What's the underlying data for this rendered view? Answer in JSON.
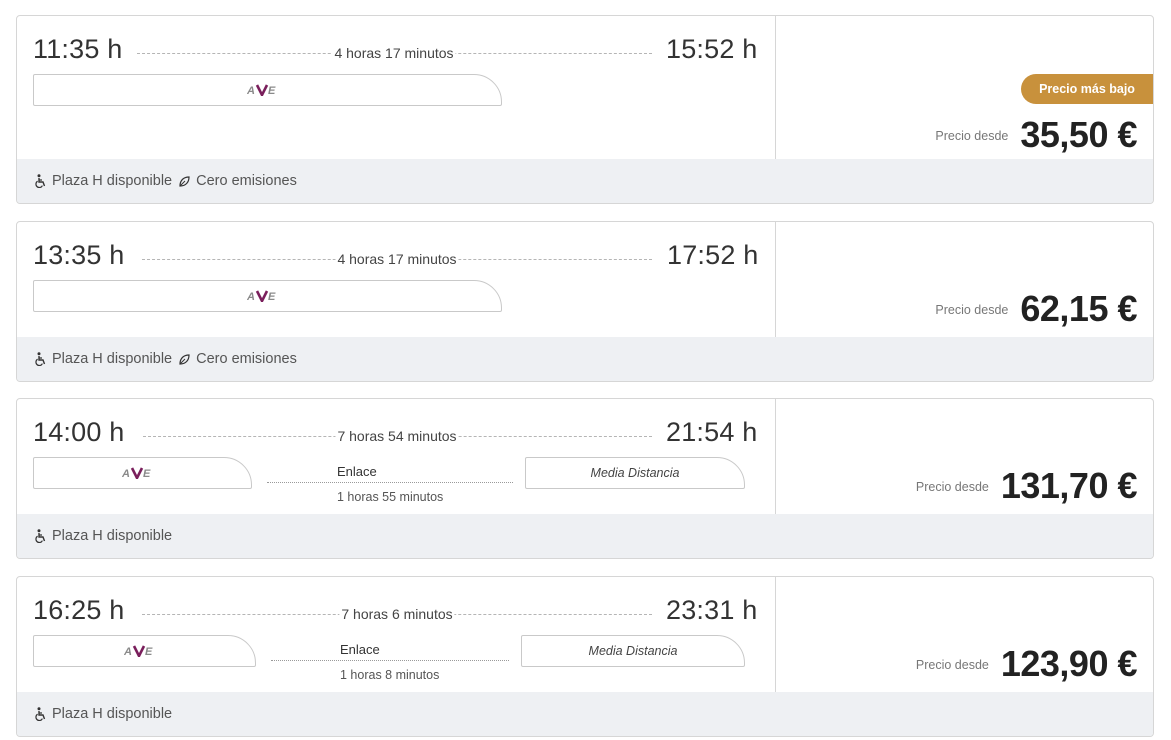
{
  "results": [
    {
      "departure": "11:35 h",
      "arrival": "15:52 h",
      "duration": "4 horas 17 minutos",
      "segments": [
        {
          "brand": "AVE"
        }
      ],
      "badge": "Precio más bajo",
      "price_label": "Precio desde",
      "price": "35,50 €",
      "features": [
        "Plaza H disponible",
        "Cero emisiones"
      ]
    },
    {
      "departure": "13:35 h",
      "arrival": "17:52 h",
      "duration": "4 horas 17 minutos",
      "segments": [
        {
          "brand": "AVE"
        }
      ],
      "price_label": "Precio desde",
      "price": "62,15 €",
      "features": [
        "Plaza H disponible",
        "Cero emisiones"
      ]
    },
    {
      "departure": "14:00 h",
      "arrival": "21:54 h",
      "duration": "7 horas 54 minutos",
      "segments": [
        {
          "brand": "AVE"
        },
        {
          "brand": "Media Distancia"
        }
      ],
      "connection_label": "Enlace",
      "connection_duration": "1 horas 55 minutos",
      "price_label": "Precio desde",
      "price": "131,70 €",
      "features": [
        "Plaza H disponible"
      ]
    },
    {
      "departure": "16:25 h",
      "arrival": "23:31 h",
      "duration": "7 horas 6 minutos",
      "segments": [
        {
          "brand": "AVE"
        },
        {
          "brand": "Media Distancia"
        }
      ],
      "connection_label": "Enlace",
      "connection_duration": "1 horas 8 minutos",
      "price_label": "Precio desde",
      "price": "123,90 €",
      "features": [
        "Plaza H disponible"
      ]
    }
  ],
  "colors": {
    "badge": "#c8913c",
    "ave_purple": "#7a1f5c",
    "footer_bg": "#eef0f3"
  },
  "icons": {
    "accessibility": "wheelchair-icon",
    "eco": "leaf-icon"
  }
}
